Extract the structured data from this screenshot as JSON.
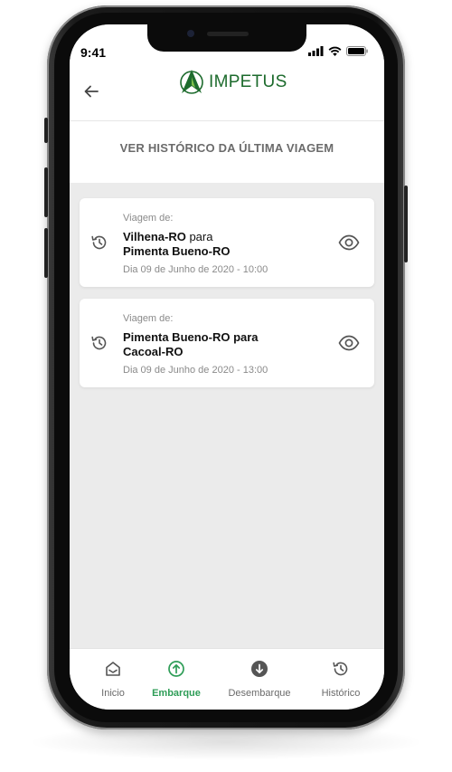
{
  "status_bar": {
    "time": "9:41"
  },
  "header": {
    "brand": "IMPETUS",
    "back_icon": "arrow-left-icon"
  },
  "page": {
    "subtitle": "VER HISTÓRICO DA ÚLTIMA VIAGEM"
  },
  "trips": [
    {
      "label": "Viagem de:",
      "origin": "Vilhena-RO",
      "connector": " para",
      "destination": "Pimenta Bueno-RO",
      "date": "Dia 09 de Junho de 2020 - 10:00"
    },
    {
      "label": "Viagem de:",
      "origin": "Pimenta Bueno-RO para",
      "connector": "",
      "destination": "Cacoal-RO",
      "date": "Dia 09 de Junho de 2020 - 13:00"
    }
  ],
  "tabs": [
    {
      "label": "Inicio",
      "icon": "home-icon",
      "active": false
    },
    {
      "label": "Embarque",
      "icon": "arrow-up-circle-icon",
      "active": true
    },
    {
      "label": "Desembarque",
      "icon": "arrow-down-circle-icon",
      "active": false
    },
    {
      "label": "Histórico",
      "icon": "history-icon",
      "active": false
    }
  ],
  "colors": {
    "brand_green": "#1d6b2d",
    "active_tab": "#2e9d57",
    "background": "#ebebeb"
  }
}
